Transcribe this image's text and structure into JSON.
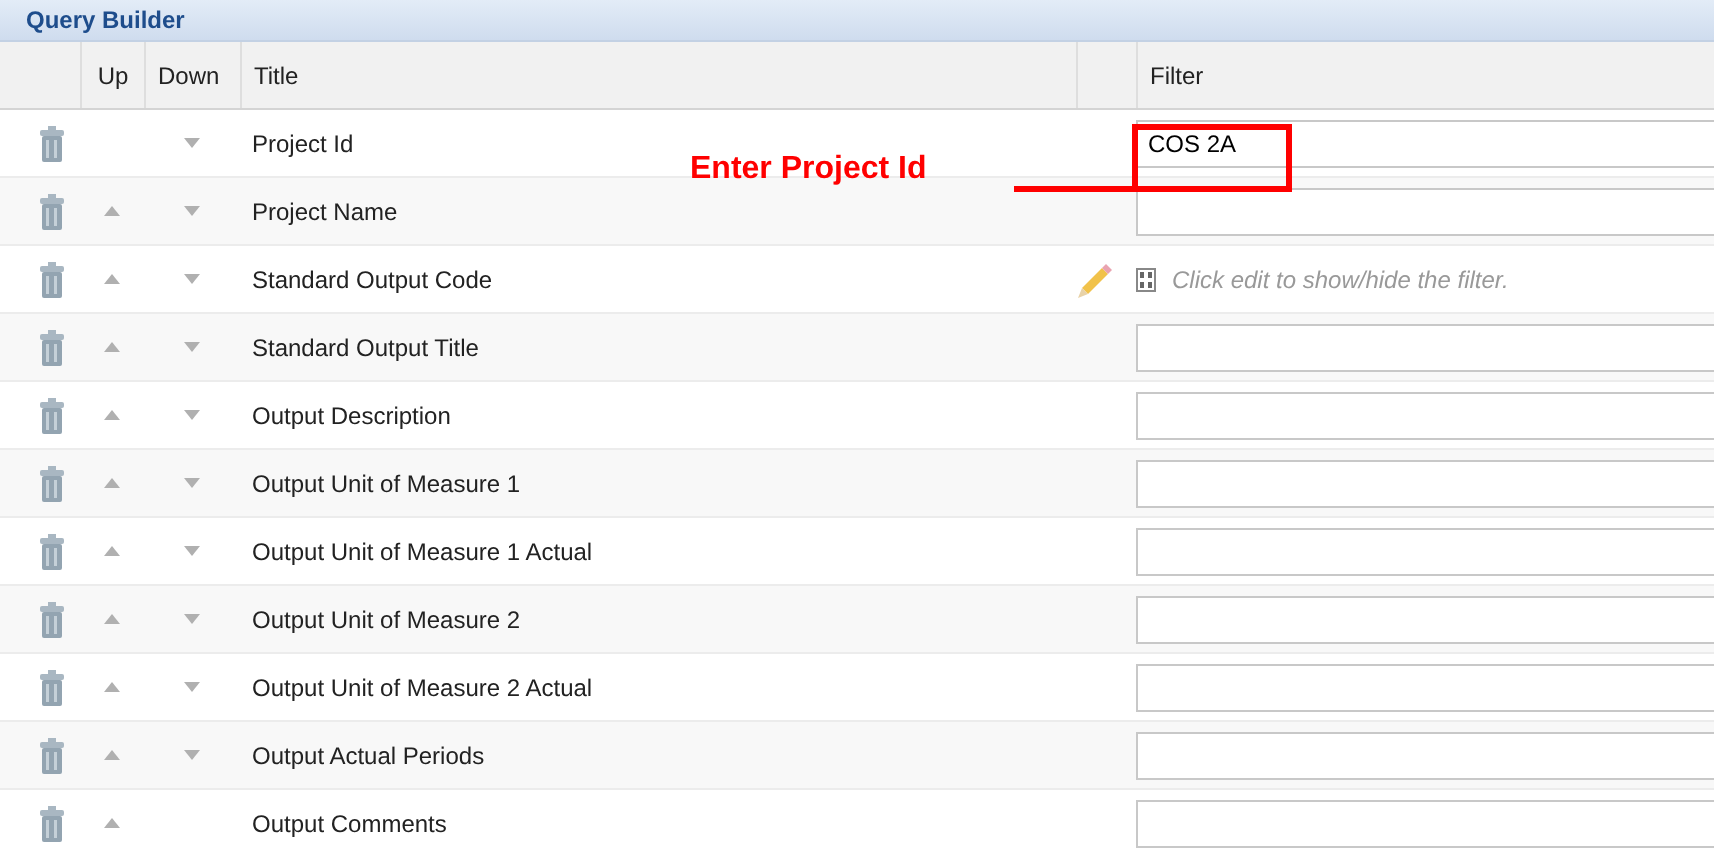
{
  "panel": {
    "title": "Query Builder"
  },
  "columns": [
    "Up",
    "Down",
    "Title",
    "Filter"
  ],
  "rows": [
    {
      "title": "Project Id",
      "up": false,
      "down": true,
      "filter": {
        "kind": "input",
        "value": "COS 2A"
      }
    },
    {
      "title": "Project Name",
      "up": true,
      "down": true,
      "filter": {
        "kind": "input"
      }
    },
    {
      "title": "Standard Output Code",
      "up": true,
      "down": true,
      "filter": {
        "kind": "hint",
        "text": "Click edit to show/hide the filter."
      }
    },
    {
      "title": "Standard Output Title",
      "up": true,
      "down": true,
      "filter": {
        "kind": "input"
      }
    },
    {
      "title": "Output Description",
      "up": true,
      "down": true,
      "filter": {
        "kind": "input"
      }
    },
    {
      "title": "Output Unit of Measure 1",
      "up": true,
      "down": true,
      "filter": {
        "kind": "input"
      }
    },
    {
      "title": "Output Unit of Measure 1 Actual",
      "up": true,
      "down": true,
      "filter": {
        "kind": "input"
      }
    },
    {
      "title": "Output Unit of Measure 2",
      "up": true,
      "down": true,
      "filter": {
        "kind": "input"
      }
    },
    {
      "title": "Output Unit of Measure 2 Actual",
      "up": true,
      "down": true,
      "filter": {
        "kind": "input"
      }
    },
    {
      "title": "Output Actual Periods",
      "up": true,
      "down": true,
      "filter": {
        "kind": "input"
      }
    },
    {
      "title": "Output Comments",
      "up": true,
      "down": false,
      "filter": {
        "kind": "input"
      }
    }
  ],
  "annotation": {
    "label": "Enter Project Id"
  }
}
